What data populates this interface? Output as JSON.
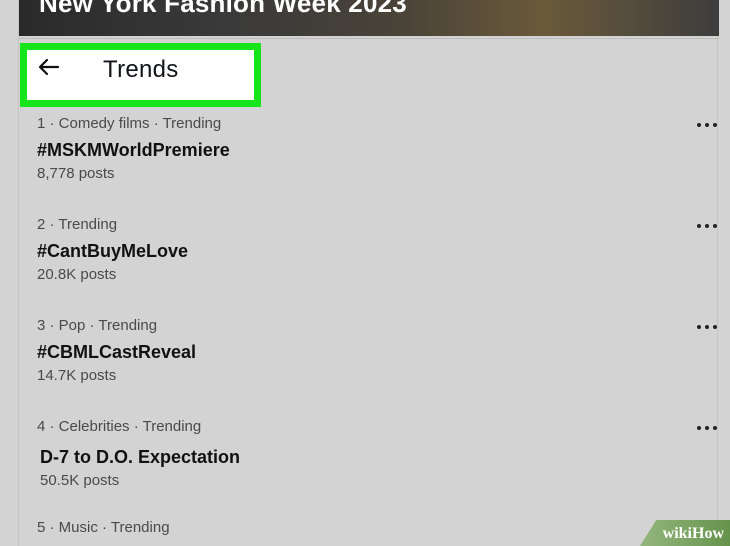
{
  "banner": {
    "title": "New York Fashion Week 2023"
  },
  "header": {
    "back_icon": "left-arrow-icon",
    "title": "Trends",
    "highlight_color": "#15e51a"
  },
  "trends": [
    {
      "meta": "1 · Comedy films · Trending",
      "name": "#MSKMWorldPremiere",
      "count": "8,778 posts"
    },
    {
      "meta": "2 · Trending",
      "name": "#CantBuyMeLove",
      "count": "20.8K posts"
    },
    {
      "meta": "3 · Pop · Trending",
      "name": "#CBMLCastReveal",
      "count": "14.7K posts"
    },
    {
      "meta": "4 · Celebrities · Trending",
      "name": "D-7 to D.O. Expectation",
      "count": "50.5K posts"
    },
    {
      "meta": "5 · Music · Trending",
      "name": "",
      "count": ""
    }
  ],
  "watermark": {
    "text": "wikiHow"
  }
}
